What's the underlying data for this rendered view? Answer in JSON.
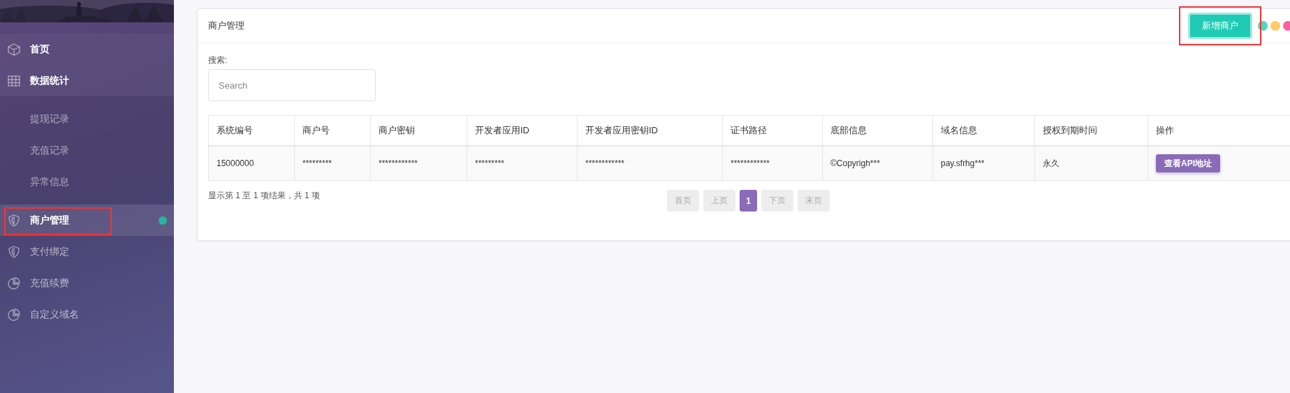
{
  "sidebar": {
    "items": [
      {
        "label": "首页",
        "selected": false,
        "highlighted": false,
        "kind": "main"
      },
      {
        "label": "数据统计",
        "selected": false,
        "highlighted": false,
        "kind": "group",
        "children": [
          {
            "label": "提现记录",
            "selected": false
          },
          {
            "label": "充值记录",
            "selected": false
          },
          {
            "label": "异常信息",
            "selected": false
          }
        ]
      },
      {
        "label": "商户管理",
        "selected": true,
        "highlighted": true,
        "kind": "main"
      },
      {
        "label": "支付绑定",
        "selected": false,
        "highlighted": false,
        "kind": "main"
      },
      {
        "label": "充值续费",
        "selected": false,
        "highlighted": false,
        "kind": "main"
      },
      {
        "label": "自定义域名",
        "selected": false,
        "highlighted": false,
        "kind": "main"
      }
    ]
  },
  "panel": {
    "title": "商户管理",
    "add_button": {
      "label": "新增商户",
      "highlighted": true
    },
    "dots": [
      {
        "color": "#4fd6c4"
      },
      {
        "color": "#ffcc66"
      },
      {
        "color": "#ff5ca8"
      }
    ],
    "search": {
      "label": "搜索:",
      "placeholder": "Search"
    },
    "table": {
      "columns": [
        "系统编号",
        "商户号",
        "商户密钥",
        "开发者应用ID",
        "开发者应用密钥ID",
        "证书路径",
        "底部信息",
        "域名信息",
        "授权到期时间",
        "操作"
      ],
      "rows": [
        {
          "cells": [
            "15000000",
            "*********",
            "************",
            "*********",
            "************",
            "************",
            "©Copyrigh***",
            "pay.sfrhg***",
            "永久"
          ],
          "action": "查看API地址"
        }
      ]
    },
    "summary": "显示第 1 至 1 项结果，共 1 项",
    "pagination": [
      {
        "label": "首页",
        "selected": false,
        "disabled": true
      },
      {
        "label": "上页",
        "selected": false,
        "disabled": true
      },
      {
        "label": "1",
        "selected": true,
        "disabled": false
      },
      {
        "label": "下页",
        "selected": false,
        "disabled": true
      },
      {
        "label": "末页",
        "selected": false,
        "disabled": true
      }
    ]
  }
}
